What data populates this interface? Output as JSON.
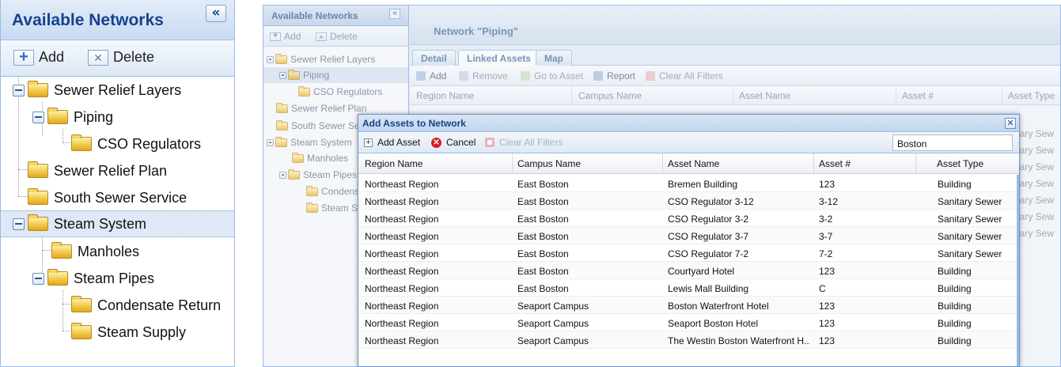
{
  "left_panel": {
    "title": "Available Networks",
    "collapse_glyph": "«",
    "toolbar": {
      "add_label": "Add",
      "delete_label": "Delete"
    },
    "tree": [
      {
        "label": "Sewer Relief Layers",
        "level": 0,
        "expanded": true
      },
      {
        "label": "Piping",
        "level": 1,
        "expanded": true
      },
      {
        "label": "CSO Regulators",
        "level": 2
      },
      {
        "label": "Sewer Relief Plan",
        "level": 0
      },
      {
        "label": "South Sewer Service",
        "level": 0
      },
      {
        "label": "Steam System",
        "level": 0,
        "expanded": true,
        "selected": true
      },
      {
        "label": "Manholes",
        "level": 1
      },
      {
        "label": "Steam Pipes",
        "level": 1,
        "expanded": true
      },
      {
        "label": "Condensate Return",
        "level": 2
      },
      {
        "label": "Steam Supply",
        "level": 2
      }
    ]
  },
  "background_app": {
    "left": {
      "title": "Available Networks",
      "collapse_glyph": "«",
      "add_label": "Add",
      "delete_label": "Delete",
      "tree": [
        "Sewer Relief Layers",
        "Piping",
        "CSO Regulators",
        "Sewer Relief Plan",
        "South Sewer Se",
        "Steam System",
        "Manholes",
        "Steam Pipes",
        "Condens",
        "Steam S"
      ]
    },
    "network_title": "Network \"Piping\"",
    "tabs": [
      "Detail",
      "Linked Assets",
      "Map"
    ],
    "active_tab": "Linked Assets",
    "toolbar": {
      "add": "Add",
      "remove": "Remove",
      "go_to_asset": "Go to Asset",
      "report": "Report",
      "clear_filters": "Clear All Filters"
    },
    "columns": [
      "Region Name",
      "Campus Name",
      "Asset Name",
      "Asset #",
      "Asset Type"
    ],
    "visible_type_cells": [
      "nitary Sew",
      "nitary Sew",
      "nitary Sew",
      "nitary Sew",
      "nitary Sew",
      "nitary Sew",
      "nitary Sew"
    ]
  },
  "modal": {
    "title": "Add Assets to Network",
    "close_glyph": "✕",
    "toolbar": {
      "add_asset": "Add Asset",
      "cancel": "Cancel",
      "clear_filters": "Clear All Filters"
    },
    "search_value": "Boston",
    "columns": [
      "Region Name",
      "Campus Name",
      "Asset Name",
      "Asset #",
      "Asset Type"
    ],
    "rows": [
      [
        "Northeast Region",
        "East Boston",
        "Bremen Building",
        "123",
        "Building"
      ],
      [
        "Northeast Region",
        "East Boston",
        "CSO Regulator 3-12",
        "3-12",
        "Sanitary Sewer"
      ],
      [
        "Northeast Region",
        "East Boston",
        "CSO Regulator 3-2",
        "3-2",
        "Sanitary Sewer"
      ],
      [
        "Northeast Region",
        "East Boston",
        "CSO Regulator 3-7",
        "3-7",
        "Sanitary Sewer"
      ],
      [
        "Northeast Region",
        "East Boston",
        "CSO Regulator 7-2",
        "7-2",
        "Sanitary Sewer"
      ],
      [
        "Northeast Region",
        "East Boston",
        "Courtyard Hotel",
        "123",
        "Building"
      ],
      [
        "Northeast Region",
        "East Boston",
        "Lewis Mall Building",
        "C",
        "Building"
      ],
      [
        "Northeast Region",
        "Seaport Campus",
        "Boston Waterfront Hotel",
        "123",
        "Building"
      ],
      [
        "Northeast Region",
        "Seaport Campus",
        "Seaport Boston Hotel",
        "123",
        "Building"
      ],
      [
        "Northeast Region",
        "Seaport Campus",
        "The Westin Boston Waterfront H...",
        "123",
        "Building"
      ]
    ]
  },
  "colors": {
    "header_text": "#15428b",
    "border": "#99bbe8",
    "cancel_red": "#d32020",
    "folder": "#f2c94c"
  }
}
